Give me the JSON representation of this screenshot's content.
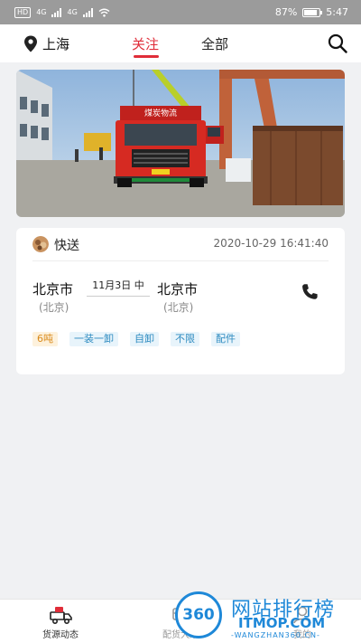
{
  "status_bar": {
    "carrier_badges": [
      "HD",
      "4G",
      "4G"
    ],
    "battery_percent": "87%",
    "battery_level": 0.87,
    "time": "5:47"
  },
  "top_nav": {
    "location": "上海",
    "tabs": [
      {
        "label": "关注",
        "active": true
      },
      {
        "label": "全部",
        "active": false
      }
    ],
    "accent_color": "#e02d39"
  },
  "banner": {
    "truck_sign": "煤炭物流",
    "plate": "京A·88888"
  },
  "cargo_card": {
    "type_label": "快送",
    "timestamp": "2020-10-29 16:41:40",
    "origin_city": "北京市",
    "origin_province": "(北京)",
    "load_date": "11月3日 中",
    "dest_city": "北京市",
    "dest_province": "(北京)",
    "tags": [
      "6吨",
      "一装一卸",
      "自卸",
      "不限",
      "配件"
    ]
  },
  "bottom_nav": {
    "items": [
      {
        "label": "货源动态",
        "icon": "truck-icon"
      },
      {
        "label": "配货大厅",
        "icon": "cart-icon"
      },
      {
        "label": "我的",
        "icon": "user-icon"
      }
    ]
  },
  "watermark": {
    "badge": "360",
    "title": "网站排行榜",
    "domain": "ITMOP.COM",
    "sub": "-WANGZHAN360.CN-"
  }
}
